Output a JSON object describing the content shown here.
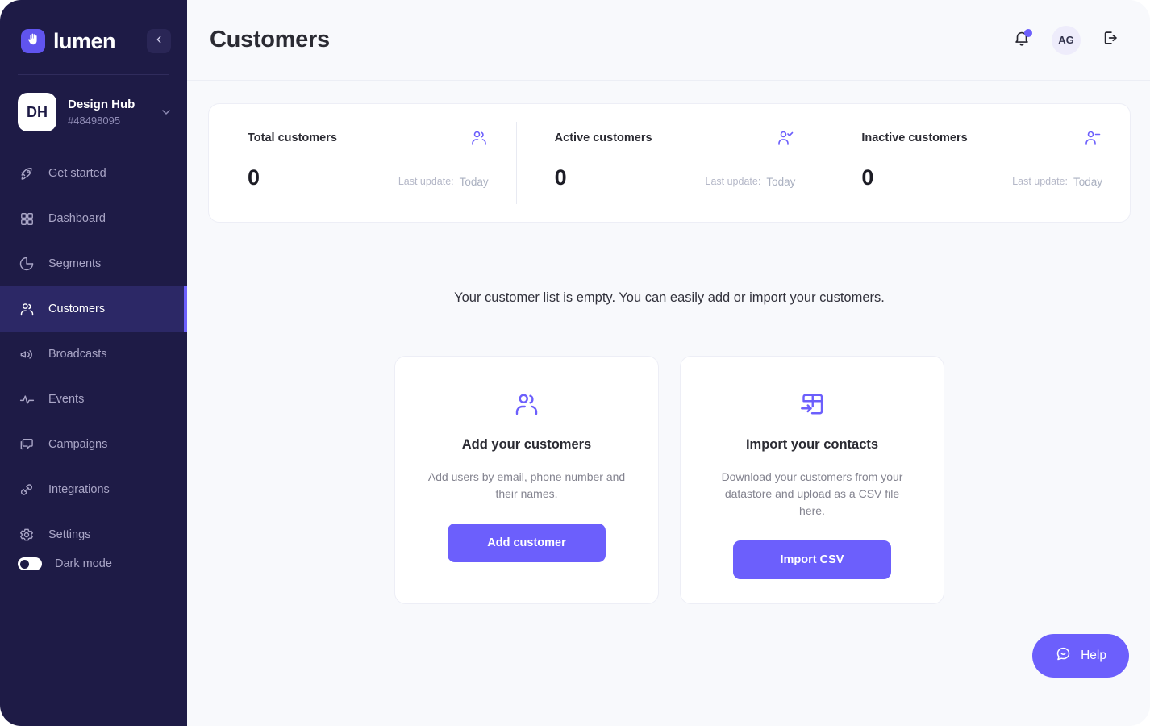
{
  "sidebar": {
    "brand": {
      "name": "lumen",
      "logo_icon": "hand-palm-icon"
    },
    "collapse_icon": "chevron-left-icon",
    "workspace": {
      "initials": "DH",
      "name": "Design Hub",
      "id": "#48498095",
      "chevron_icon": "chevron-down-icon"
    },
    "items": [
      {
        "label": "Get started",
        "icon": "rocket-icon",
        "active": false
      },
      {
        "label": "Dashboard",
        "icon": "grid-icon",
        "active": false
      },
      {
        "label": "Segments",
        "icon": "pie-chart-icon",
        "active": false
      },
      {
        "label": "Customers",
        "icon": "users-icon",
        "active": true
      },
      {
        "label": "Broadcasts",
        "icon": "speaker-icon",
        "active": false
      },
      {
        "label": "Events",
        "icon": "activity-icon",
        "active": false
      },
      {
        "label": "Campaigns",
        "icon": "message-icon",
        "active": false
      },
      {
        "label": "Integrations",
        "icon": "plug-icon",
        "active": false
      },
      {
        "label": "Settings",
        "icon": "gear-icon",
        "active": false
      }
    ],
    "dark_mode": {
      "label": "Dark mode",
      "enabled": false
    }
  },
  "header": {
    "title": "Customers",
    "notifications_icon": "bell-icon",
    "has_notification": true,
    "avatar_initials": "AG",
    "logout_icon": "logout-icon"
  },
  "stats": [
    {
      "label": "Total customers",
      "value": "0",
      "update_label": "Last update:",
      "update_value": "Today",
      "icon": "users-icon"
    },
    {
      "label": "Active customers",
      "value": "0",
      "update_label": "Last update:",
      "update_value": "Today",
      "icon": "user-check-icon"
    },
    {
      "label": "Inactive customers",
      "value": "0",
      "update_label": "Last update:",
      "update_value": "Today",
      "icon": "user-minus-icon"
    }
  ],
  "empty_state": {
    "message": "Your customer list is empty. You can easily add or import your customers.",
    "cards": [
      {
        "icon": "users-icon",
        "title": "Add your customers",
        "description": "Add users by email, phone number and their names.",
        "button": "Add customer"
      },
      {
        "icon": "table-import-icon",
        "title": "Import your contacts",
        "description": "Download your customers from your datastore and upload as a CSV file here.",
        "button": "Import CSV"
      }
    ]
  },
  "help": {
    "label": "Help",
    "icon": "chat-smile-icon"
  },
  "colors": {
    "sidebar_bg": "#1e1b46",
    "sidebar_active_bg": "#2c2866",
    "accent": "#6c5ffc",
    "page_bg": "#f8f9fc",
    "card_bg": "#ffffff"
  }
}
